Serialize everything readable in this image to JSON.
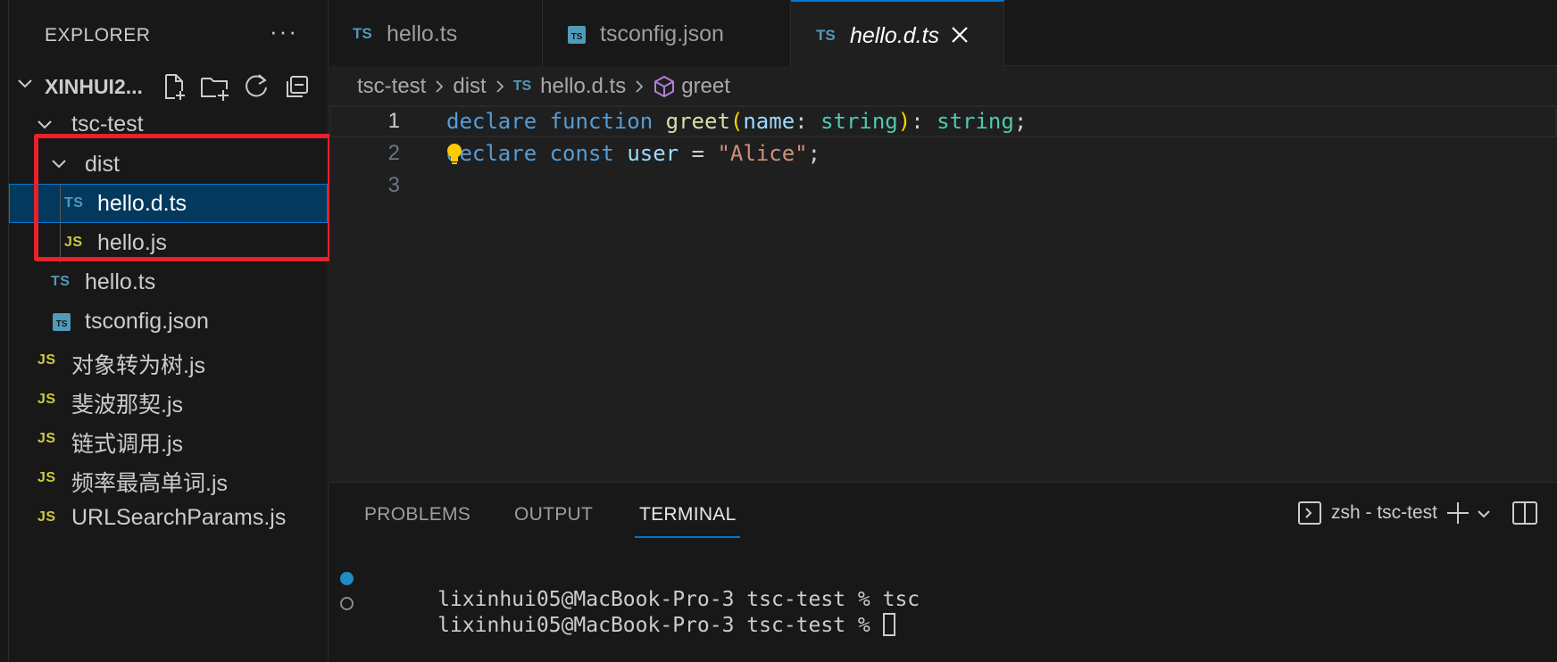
{
  "sidebar": {
    "title": "EXPLORER",
    "more": "···",
    "root_label": "XINHUI2...",
    "items": [
      {
        "label": "tsc-test",
        "kind": "folder"
      },
      {
        "label": "dist",
        "kind": "folder"
      },
      {
        "label": "hello.d.ts",
        "kind": "file",
        "badge": "TS"
      },
      {
        "label": "hello.js",
        "kind": "file",
        "badge": "JS"
      },
      {
        "label": "hello.ts",
        "kind": "file",
        "badge": "TS"
      },
      {
        "label": "tsconfig.json",
        "kind": "file",
        "badge": "TS"
      },
      {
        "label": "对象转为树.js",
        "kind": "file",
        "badge": "JS"
      },
      {
        "label": "斐波那契.js",
        "kind": "file",
        "badge": "JS"
      },
      {
        "label": "链式调用.js",
        "kind": "file",
        "badge": "JS"
      },
      {
        "label": "频率最高单词.js",
        "kind": "file",
        "badge": "JS"
      },
      {
        "label": "URLSearchParams.js",
        "kind": "file",
        "badge": "JS"
      }
    ]
  },
  "tabs": [
    {
      "label": "hello.ts",
      "icon": "TS"
    },
    {
      "label": "tsconfig.json",
      "icon": "TS"
    },
    {
      "label": "hello.d.ts",
      "icon": "TS",
      "active": true
    }
  ],
  "breadcrumb": {
    "parts": [
      "tsc-test",
      "dist",
      "hello.d.ts",
      "greet"
    ],
    "file_badge": "TS"
  },
  "code": {
    "line_numbers": [
      "1",
      "2",
      "3"
    ],
    "line1": {
      "kw1": "declare",
      "kw2": "function",
      "fn": "greet",
      "paren_open": "(",
      "param": "name",
      "colon1": ": ",
      "type1": "string",
      "paren_close": ")",
      "colon2": ": ",
      "type2": "string",
      "semi": ";"
    },
    "line2": {
      "kw1": "declare",
      "kw2": "const",
      "var": "user",
      "eq": " = ",
      "str": "\"Alice\"",
      "semi": ";"
    }
  },
  "panel": {
    "tabs": [
      "PROBLEMS",
      "OUTPUT",
      "TERMINAL"
    ],
    "active_tab": "TERMINAL",
    "terminal_name": "zsh - tsc-test",
    "lines": [
      "lixinhui05@MacBook-Pro-3 tsc-test % tsc",
      "lixinhui05@MacBook-Pro-3 tsc-test % "
    ]
  },
  "colors": {
    "ts_badge": "#519aba",
    "js_badge": "#cbcb41",
    "selection": "#04395e",
    "highlight": "#e8212b",
    "accent": "#0078d4"
  }
}
